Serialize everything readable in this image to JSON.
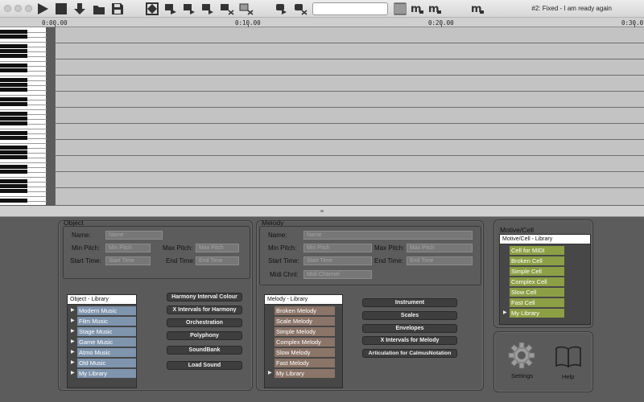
{
  "toolbar": {
    "buttons": [
      {
        "name": "play-icon"
      },
      {
        "name": "stop-icon"
      },
      {
        "name": "download-icon"
      },
      {
        "name": "open-folder-icon"
      },
      {
        "name": "save-disk-icon"
      },
      {
        "name": "fit-view-icon"
      },
      {
        "name": "score-icon-1"
      },
      {
        "name": "score-icon-2"
      },
      {
        "name": "score-icon-3"
      },
      {
        "name": "score-clear-icon"
      },
      {
        "name": "score-delete-icon"
      },
      {
        "name": "score-icon-4"
      },
      {
        "name": "score-delete-icon-2"
      }
    ],
    "search_value": "",
    "status": "#2: Fixed - I am ready again"
  },
  "timeline": {
    "ticks": [
      "0:00.00",
      "0:10.00",
      "0:20.00",
      "0:30.0"
    ]
  },
  "object": {
    "title": "Object",
    "name_label": "Name:",
    "name_placeholder": "Name",
    "min_pitch_label": "Min Pitch:",
    "min_pitch_placeholder": "Min Pitch",
    "max_pitch_label": "Max Pitch:",
    "max_pitch_placeholder": "Max Pitch",
    "start_time_label": "Start Time:",
    "start_time_placeholder": "Start Time",
    "end_time_label": "End Time:",
    "end_time_placeholder": "End Time",
    "library_header": "Object - Library",
    "library_items": [
      "Modern Music",
      "Film Music",
      "Stage Music",
      "Game Music",
      "Atmo Music",
      "Old Music",
      "My Library"
    ],
    "buttons": [
      "Harmony Interval Colour",
      "X Intervals for Harmony",
      "Orchestration",
      "Polyphony",
      "SoundBank",
      "Load Sound"
    ]
  },
  "melody": {
    "title": "Melody",
    "name_label": "Name:",
    "name_placeholder": "Name",
    "min_pitch_label": "Min Pitch:",
    "min_pitch_placeholder": "Min Pitch",
    "max_pitch_label": "Max Pitch:",
    "max_pitch_placeholder": "Max Pitch",
    "start_time_label": "Start Time:",
    "start_time_placeholder": "Start Time",
    "end_time_label": "End Time:",
    "end_time_placeholder": "End Time",
    "midi_channel_label": "Midi Chnl:",
    "midi_channel_placeholder": "Midi Channel",
    "library_header": "Melody - Library",
    "library_items": [
      "Broken Melody",
      "Scale Melody",
      "Simple Melody",
      "Complex Melody",
      "Slow Melody",
      "Fast Melody",
      "My Library"
    ],
    "buttons": [
      "Instrument",
      "Scales",
      "Envelopes",
      "X Intervals for Melody",
      "Articulation for CalmusNotation"
    ]
  },
  "motive": {
    "title": "Motive/Cell",
    "library_header": "Motive/Cell  - Library",
    "library_items": [
      "Cell for MIDI",
      "Broken Cell",
      "Simple Cell",
      "Complex Cell",
      "Slow Cell",
      "Fast Cell",
      "My Library"
    ]
  },
  "footer": {
    "settings_label": "Settings",
    "help_label": "Help"
  }
}
